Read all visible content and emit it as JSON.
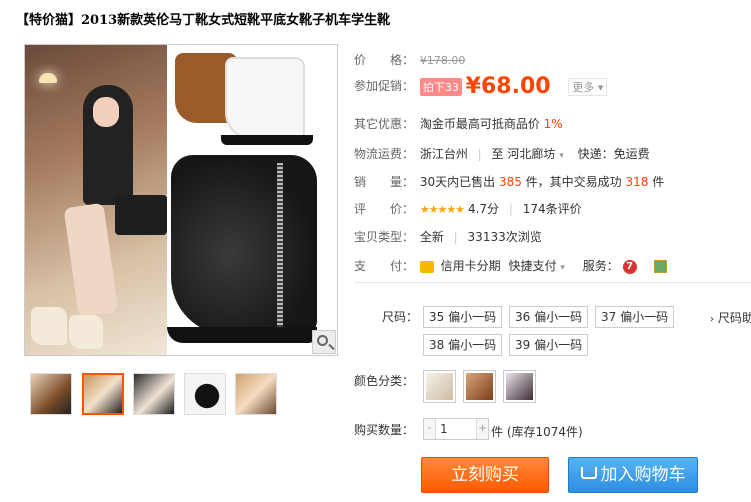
{
  "title": "【特价猫】2013新款英伦马丁靴女式短靴平底女靴子机车学生靴",
  "price": {
    "label": "价　　格：",
    "original": "¥178.00"
  },
  "promo": {
    "label": "参加促销：",
    "tag": "拍下33",
    "currency": "¥",
    "value": "68.00",
    "more": "更多 ▾"
  },
  "other": {
    "label": "其它优惠：",
    "text": "淘金币最高可抵商品价",
    "percent": "1%"
  },
  "shipping": {
    "label": "物流运费：",
    "from": "浙江台州",
    "to_prefix": "至",
    "to": "河北廊坊",
    "fee": "快递：免运费"
  },
  "sales": {
    "label": "销　　量：",
    "prefix": "30天内已售出",
    "count": "385",
    "mid": "件，其中交易成功",
    "success": "318",
    "suffix": "件"
  },
  "rating": {
    "label": "评　　价：",
    "stars": "★★★★★",
    "score": "4.7分",
    "reviews": "174条评价"
  },
  "type": {
    "label": "宝贝类型：",
    "condition": "全新",
    "views": "33133次浏览"
  },
  "payment": {
    "label": "支　　付：",
    "card": "信用卡分期",
    "quick": "快捷支付",
    "service_label": "服务：",
    "badge": "7"
  },
  "size": {
    "label": "尺码：",
    "options": [
      "35 偏小一码",
      "36 偏小一码",
      "37 偏小一码",
      "38 偏小一码",
      "39 偏小一码"
    ],
    "chart_link": "尺码助"
  },
  "color": {
    "label": "颜色分类："
  },
  "quantity": {
    "label": "购买数量：",
    "value": "1",
    "minus": "-",
    "plus": "+",
    "stock": "件 (库存1074件)"
  },
  "buttons": {
    "buy": "立刻购买",
    "cart": "加入购物车"
  },
  "colors": {
    "accent": "#ff4400",
    "buy_button": "#ff6a00",
    "cart_button": "#3a9ae8"
  }
}
